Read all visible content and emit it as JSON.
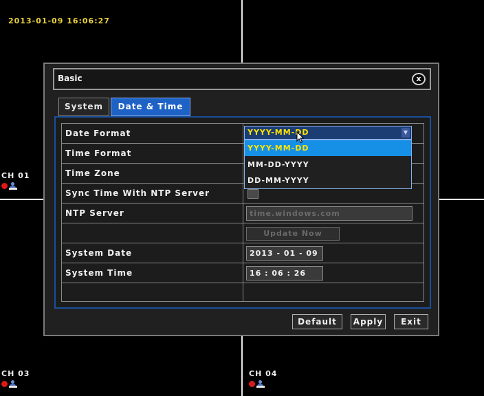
{
  "osd": {
    "datetime": "2013-01-09  16:06:27",
    "channels": [
      {
        "label": "CH  01"
      },
      {
        "label": "CH  03"
      },
      {
        "label": "CH  04"
      }
    ]
  },
  "dialog": {
    "title": "Basic",
    "close_glyph": "x",
    "tabs": [
      {
        "label": "System",
        "active": false
      },
      {
        "label": "Date & Time",
        "active": true
      }
    ],
    "rows": {
      "date_format": {
        "label": "Date Format",
        "value": "YYYY-MM-DD"
      },
      "time_format": {
        "label": "Time Format"
      },
      "time_zone": {
        "label": "Time Zone"
      },
      "ntp_sync": {
        "label": "Sync Time With NTP Server",
        "checked": false
      },
      "ntp_server": {
        "label": "NTP Server",
        "value": "time.windows.com"
      },
      "update_now": {
        "label": "Update Now"
      },
      "system_date": {
        "label": "System Date",
        "value": "2013 - 01 - 09"
      },
      "system_time": {
        "label": "System Time",
        "value": "16 : 06 : 26"
      }
    },
    "date_format_options": [
      "YYYY-MM-DD",
      "MM-DD-YYYY",
      "DD-MM-YYYY"
    ],
    "selected_option": "YYYY-MM-DD",
    "buttons": {
      "default": "Default",
      "apply": "Apply",
      "exit": "Exit"
    }
  },
  "colors": {
    "accent": "#1e62c6",
    "highlight": "#1590e6",
    "selected_text": "#ffe400",
    "osd_time": "#e8d23a",
    "record": "#e01818"
  },
  "icons": {
    "record": "record-dot-icon",
    "user": "user-icon",
    "close": "close-icon",
    "dropdown": "chevron-down-icon",
    "cursor": "mouse-cursor-icon"
  }
}
